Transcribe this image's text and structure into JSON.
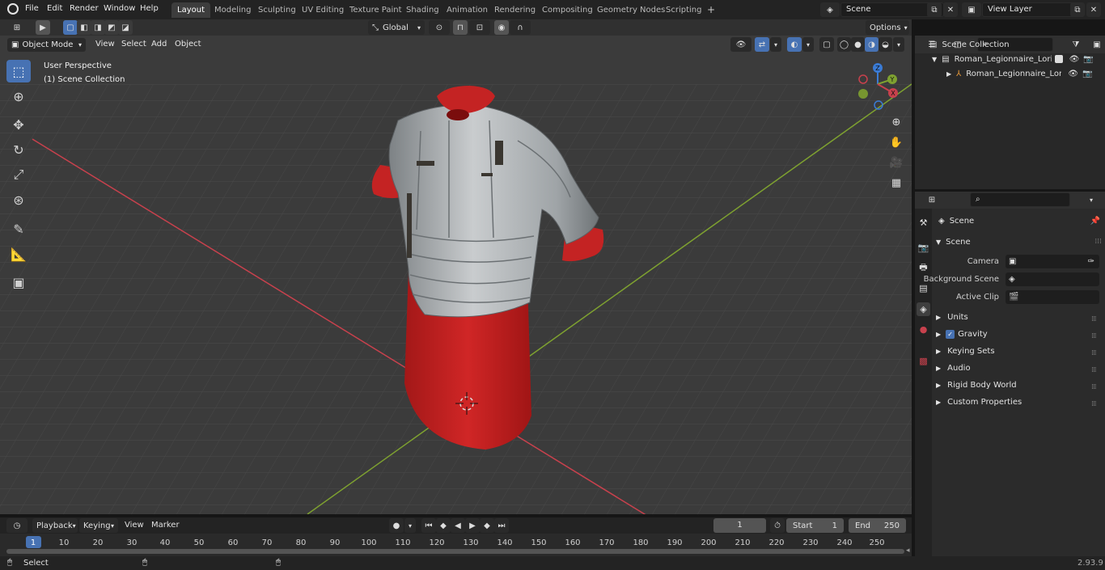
{
  "topbar": {
    "menus": [
      "File",
      "Edit",
      "Render",
      "Window",
      "Help"
    ],
    "workspaces": [
      "Layout",
      "Modeling",
      "Sculpting",
      "UV Editing",
      "Texture Paint",
      "Shading",
      "Animation",
      "Rendering",
      "Compositing",
      "Geometry Nodes",
      "Scripting"
    ],
    "active_workspace": "Layout",
    "add_tab": "+",
    "scene_field": "Scene",
    "view_layer_field": "View Layer"
  },
  "header": {
    "transform_orientation": "Global",
    "options_label": "Options"
  },
  "viewport": {
    "mode": "Object Mode",
    "menus": [
      "View",
      "Select",
      "Add",
      "Object"
    ],
    "perspective_label": "User Perspective",
    "collection_label": "(1) Scene Collection",
    "gizmo_axes": {
      "x": "X",
      "y": "Y",
      "z": "Z"
    }
  },
  "outliner": {
    "items": [
      {
        "label": "Scene Collection"
      },
      {
        "label": "Roman_Legionnaire_Lorica_V"
      },
      {
        "label": "Roman_Legionnaire_Lori"
      }
    ]
  },
  "properties": {
    "context_label": "Scene",
    "panel_title": "Scene",
    "camera_label": "Camera",
    "background_scene_label": "Background Scene",
    "active_clip_label": "Active Clip",
    "subpanels": [
      "Units",
      "Gravity",
      "Keying Sets",
      "Audio",
      "Rigid Body World",
      "Custom Properties"
    ]
  },
  "timeline": {
    "menus": [
      "Playback",
      "Keying",
      "View",
      "Marker"
    ],
    "current_frame": "1",
    "start_label": "Start",
    "start_value": "1",
    "end_label": "End",
    "end_value": "250",
    "ruler": [
      "1",
      "10",
      "20",
      "30",
      "40",
      "50",
      "60",
      "70",
      "80",
      "90",
      "100",
      "110",
      "120",
      "130",
      "140",
      "150",
      "160",
      "170",
      "180",
      "190",
      "200",
      "210",
      "220",
      "230",
      "240",
      "250"
    ]
  },
  "statusbar": {
    "left_label": "Select",
    "version": "2.93.9"
  },
  "colors": {
    "accent": "#4772b3",
    "axis_x": "#c8414d",
    "axis_y": "#7ea130",
    "tunic_red": "#c42323"
  }
}
